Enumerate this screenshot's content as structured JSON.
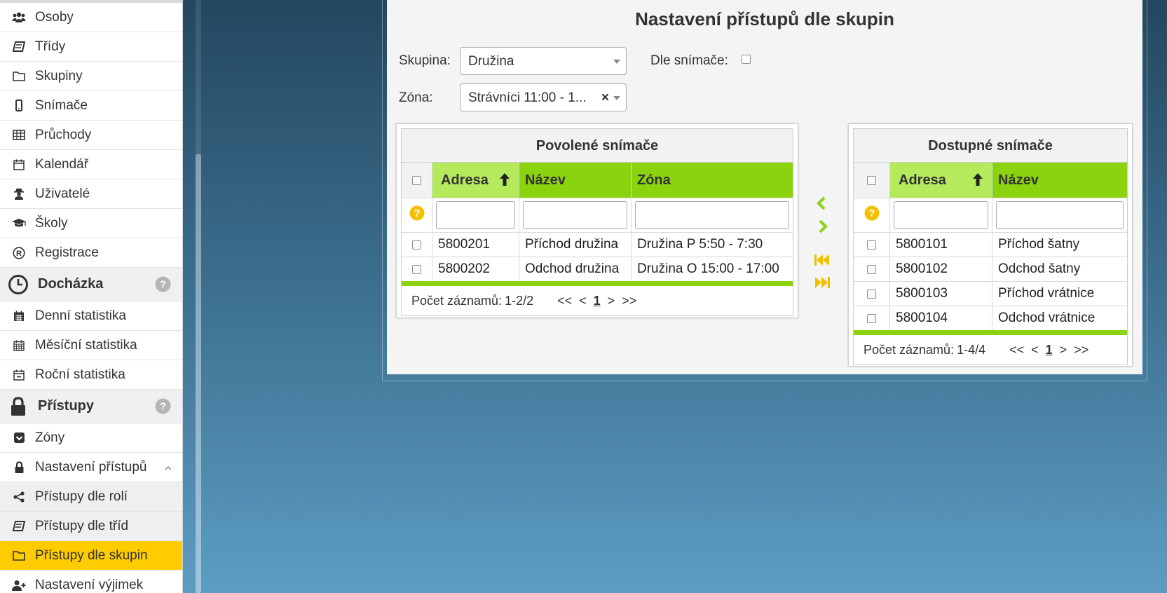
{
  "sidebar": {
    "items_top": [
      {
        "label": "Osoby",
        "icon": "users-icon"
      },
      {
        "label": "Třídy",
        "icon": "book-icon"
      },
      {
        "label": "Skupiny",
        "icon": "folder-icon"
      },
      {
        "label": "Snímače",
        "icon": "mobile-icon"
      },
      {
        "label": "Průchody",
        "icon": "table-icon"
      },
      {
        "label": "Kalendář",
        "icon": "calendar-icon"
      },
      {
        "label": "Uživatelé",
        "icon": "user-secret-icon"
      },
      {
        "label": "Školy",
        "icon": "graduation-cap-icon"
      },
      {
        "label": "Registrace",
        "icon": "registered-icon"
      }
    ],
    "section_attendance": {
      "label": "Docházka",
      "icon": "clock-icon"
    },
    "items_attendance": [
      {
        "label": "Denní statistika",
        "icon": "calendar-icon"
      },
      {
        "label": "Měsíční statistika",
        "icon": "calendar-icon"
      },
      {
        "label": "Roční statistika",
        "icon": "calendar-minus-icon"
      }
    ],
    "section_access": {
      "label": "Přístupy",
      "icon": "lock-icon"
    },
    "items_access": [
      {
        "label": "Zóny",
        "icon": "shield-icon"
      },
      {
        "label": "Nastavení přístupů",
        "icon": "lock-icon"
      },
      {
        "label": "Přístupy dle rolí",
        "icon": "share-icon"
      },
      {
        "label": "Přístupy dle tříd",
        "icon": "book-icon"
      },
      {
        "label": "Přístupy dle skupin",
        "icon": "folder-icon"
      },
      {
        "label": "Nastavení výjimek",
        "icon": "user-plus-icon"
      }
    ],
    "accent_color": "#ffcc00"
  },
  "page": {
    "title": "Nastavení přístupů dle skupin",
    "group_label": "Skupina:",
    "group_value": "Družina",
    "reader_label": "Dle snímače:",
    "zone_label": "Zóna:",
    "zone_value": "Strávníci 11:00 - 1...",
    "zone_clear": "×"
  },
  "allowed": {
    "title": "Povolené snímače",
    "columns": [
      "Adresa",
      "Název",
      "Zóna"
    ],
    "rows": [
      [
        "5800201",
        "Příchod družina",
        "Družina P 5:50 - 7:30"
      ],
      [
        "5800202",
        "Odchod družina",
        "Družina O 15:00 - 17:00"
      ]
    ],
    "count_label": "Počet záznamů:",
    "count_value": "1-2/2",
    "pager": {
      "first": "<<",
      "prev": "<",
      "current": "1",
      "next": ">",
      "last": ">>"
    }
  },
  "available": {
    "title": "Dostupné snímače",
    "columns": [
      "Adresa",
      "Název"
    ],
    "rows": [
      [
        "5800101",
        "Příchod šatny"
      ],
      [
        "5800102",
        "Odchod šatny"
      ],
      [
        "5800103",
        "Příchod vrátnice"
      ],
      [
        "5800104",
        "Odchod vrátnice"
      ]
    ],
    "count_label": "Počet záznamů:",
    "count_value": "1-4/4",
    "pager": {
      "first": "<<",
      "prev": "<",
      "current": "1",
      "next": ">",
      "last": ">>"
    }
  },
  "colors": {
    "header_green": "#8bd30f",
    "sorted_green": "#b5ea5c",
    "arrow_yellow": "#f0c000",
    "help_yellow": "#f5c000"
  }
}
